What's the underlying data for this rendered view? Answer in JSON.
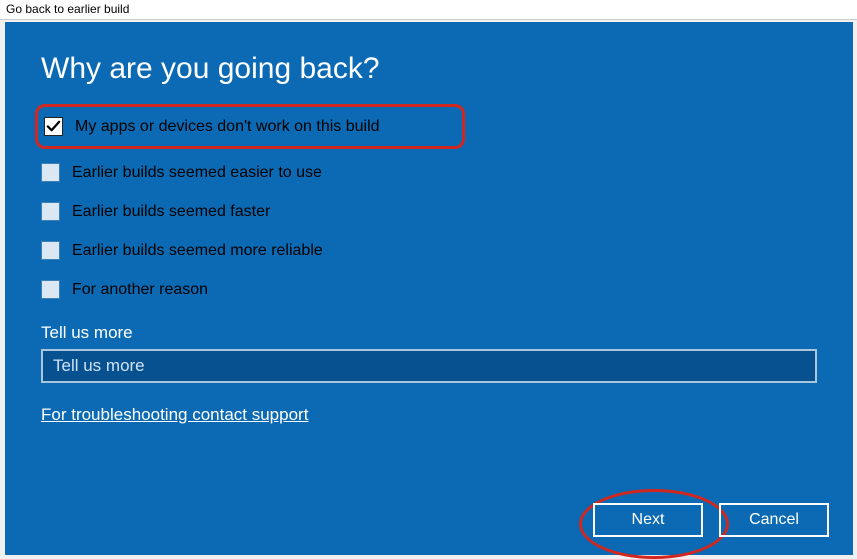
{
  "titlebar": "Go back to earlier build",
  "heading": "Why are you going back?",
  "options": {
    "opt1": {
      "label": "My apps or devices don't work on this build",
      "checked": true
    },
    "opt2": {
      "label": "Earlier builds seemed easier to use",
      "checked": false
    },
    "opt3": {
      "label": "Earlier builds seemed faster",
      "checked": false
    },
    "opt4": {
      "label": "Earlier builds seemed more reliable",
      "checked": false
    },
    "opt5": {
      "label": "For another reason",
      "checked": false
    }
  },
  "tell_us": {
    "label": "Tell us more",
    "placeholder": "Tell us more"
  },
  "support_link": "For troubleshooting contact support",
  "buttons": {
    "next": "Next",
    "cancel": "Cancel"
  }
}
